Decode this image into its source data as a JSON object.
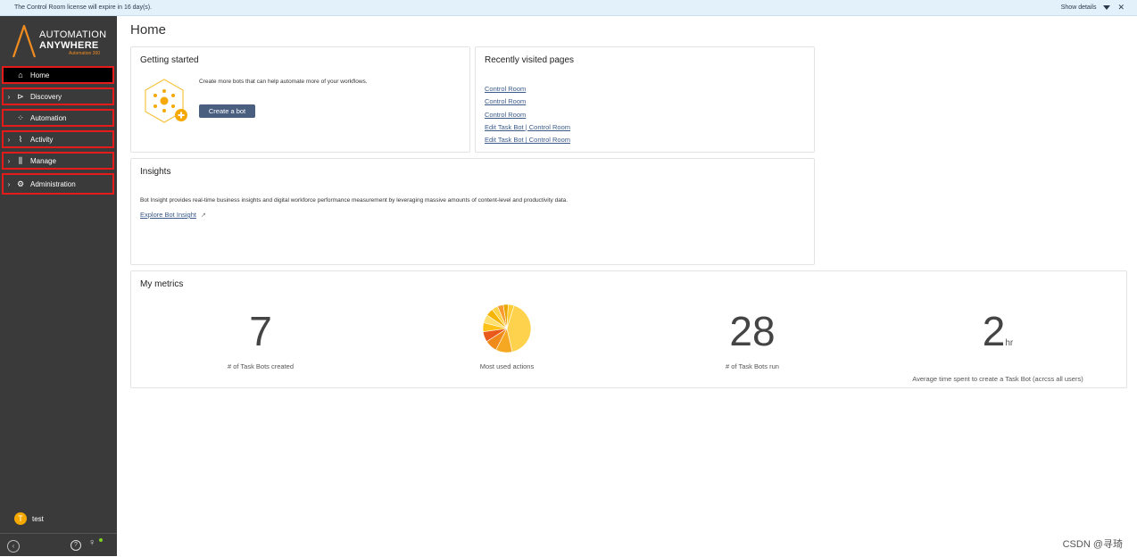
{
  "banner": {
    "message": "The Control Room license will expire in 16 day(s).",
    "show_details": "Show details",
    "close_glyph": "✕"
  },
  "logo": {
    "line1": "AUTOMATION",
    "line2": "ANYWHERE",
    "line3": "Automation 360"
  },
  "sidebar": {
    "items": [
      {
        "label": "Home",
        "icon": "home-icon",
        "glyph": "⌂",
        "active": true
      },
      {
        "label": "Discovery",
        "icon": "discovery-icon",
        "glyph": "⊳",
        "chevron": "›"
      },
      {
        "label": "Automation",
        "icon": "automation-icon",
        "glyph": "⁘"
      },
      {
        "label": "Activity",
        "icon": "activity-icon",
        "glyph": "⌇",
        "chevron": "›"
      },
      {
        "label": "Manage",
        "icon": "manage-icon",
        "glyph": "⫼",
        "chevron": "›"
      },
      {
        "label": "Administration",
        "icon": "gear-icon",
        "glyph": "⚙",
        "chevron": "›"
      }
    ],
    "user": {
      "initial": "T",
      "name": "test"
    },
    "bottom": {
      "collapse_glyph": "‹",
      "help_glyph": "?",
      "location_glyph": "♀"
    }
  },
  "page": {
    "title": "Home"
  },
  "getting_started": {
    "title": "Getting started",
    "text": "Create more bots that can help automate more of your workflows.",
    "button": "Create a bot"
  },
  "recent": {
    "title": "Recently visited pages",
    "links": [
      "Control Room",
      "Control Room",
      "Control Room",
      "Edit Task Bot | Control Room",
      "Edit Task Bot | Control Room"
    ]
  },
  "insights": {
    "title": "Insights",
    "text": "Bot Insight provides real-time business insights and digital workforce performance measurement by leveraging massive amounts of content-level and productivity data.",
    "link": "Explore Bot Insight",
    "ext_glyph": "↗"
  },
  "metrics": {
    "title": "My metrics",
    "task_bots_created": {
      "value": "7",
      "label": "# of Task Bots created"
    },
    "most_used": {
      "label": "Most used actions"
    },
    "task_bots_run": {
      "value": "28",
      "label": "# of Task Bots run"
    },
    "avg_time": {
      "value": "2",
      "unit": "hr",
      "label": "Average time spent to create a Task Bot (acrcss all users)"
    }
  },
  "pie_colors": [
    "#ffd24d",
    "#f7a823",
    "#f08a1a",
    "#e8591a",
    "#ffc21a",
    "#ffdf70",
    "#f4b400",
    "#fbd34a",
    "#f99a2e",
    "#e9a800",
    "#ffcc33"
  ],
  "watermark": "CSDN @寻琦"
}
